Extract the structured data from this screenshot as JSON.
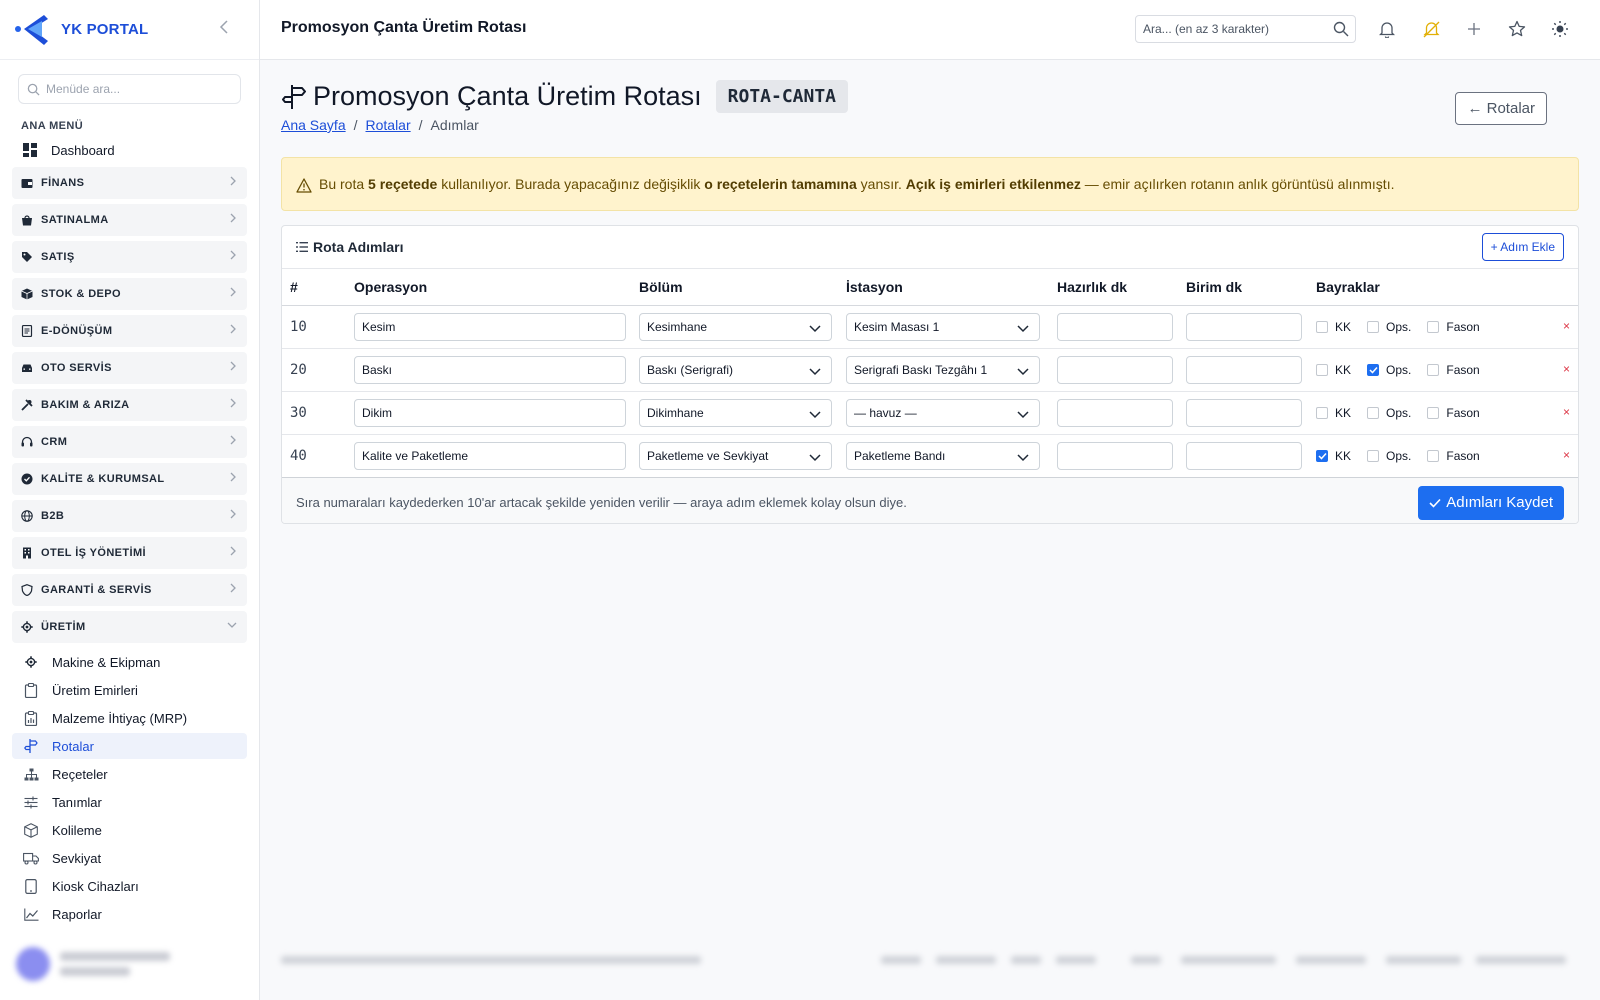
{
  "brand": {
    "name": "YK PORTAL"
  },
  "sidebar": {
    "search_placeholder": "Menüde ara...",
    "heading": "ANA MENÜ",
    "dashboard_label": "Dashboard",
    "groups": [
      {
        "label": "FİNANS",
        "icon": "wallet-icon"
      },
      {
        "label": "SATINALMA",
        "icon": "bag-icon"
      },
      {
        "label": "SATIŞ",
        "icon": "tag-icon"
      },
      {
        "label": "STOK & DEPO",
        "icon": "box-icon"
      },
      {
        "label": "E-DÖNÜŞÜM",
        "icon": "document-icon"
      },
      {
        "label": "OTO SERVİS",
        "icon": "car-icon"
      },
      {
        "label": "BAKIM & ARIZA",
        "icon": "tools-icon"
      },
      {
        "label": "CRM",
        "icon": "headset-icon"
      },
      {
        "label": "KALİTE & KURUMSAL",
        "icon": "check-badge-icon"
      },
      {
        "label": "B2B",
        "icon": "globe-icon"
      },
      {
        "label": "OTEL İŞ YÖNETİMİ",
        "icon": "building-icon"
      },
      {
        "label": "GARANTİ & SERVİS",
        "icon": "shield-icon"
      },
      {
        "label": "ÜRETİM",
        "icon": "gear-icon"
      }
    ],
    "sub_items": [
      {
        "label": "Makine & Ekipman",
        "icon": "gear-icon"
      },
      {
        "label": "Üretim Emirleri",
        "icon": "clipboard-icon"
      },
      {
        "label": "Malzeme İhtiyaç (MRP)",
        "icon": "clipboard-chart-icon"
      },
      {
        "label": "Rotalar",
        "icon": "signpost-icon"
      },
      {
        "label": "Reçeteler",
        "icon": "hierarchy-icon"
      },
      {
        "label": "Tanımlar",
        "icon": "sliders-icon"
      },
      {
        "label": "Kolileme",
        "icon": "package-icon"
      },
      {
        "label": "Sevkiyat",
        "icon": "truck-icon"
      },
      {
        "label": "Kiosk Cihazları",
        "icon": "tablet-icon"
      },
      {
        "label": "Raporlar",
        "icon": "graph-icon"
      }
    ]
  },
  "topbar": {
    "title": "Promosyon Çanta Üretim Rotası",
    "search_placeholder": "Ara... (en az 3 karakter)"
  },
  "page": {
    "title": "Promosyon Çanta Üretim Rotası",
    "code": "ROTA-CANTA",
    "back_label": "← Rotalar",
    "breadcrumb": {
      "home": "Ana Sayfa",
      "routes": "Rotalar",
      "current": "Adımlar",
      "separator": "/"
    }
  },
  "alert": {
    "t1": "Bu rota ",
    "b1": "5 reçetede",
    "t2": " kullanılıyor. Burada yapacağınız değişiklik ",
    "b2": "o reçetelerin tamamına",
    "t3": " yansır. ",
    "b3": "Açık iş emirleri etkilenmez",
    "t4": " — emir açılırken rotanın anlık görüntüsü alınmıştı."
  },
  "steps_card": {
    "title": "Rota Adımları",
    "add_label": "+ Adım Ekle",
    "columns": [
      "#",
      "Operasyon",
      "Bölüm",
      "İstasyon",
      "Hazırlık dk",
      "Birim dk",
      "Bayraklar"
    ],
    "flag_labels": {
      "kk": "KK",
      "ops": "Ops.",
      "fason": "Fason"
    },
    "delete_symbol": "×",
    "rows": [
      {
        "seq": "10",
        "operation": "Kesim",
        "department": "Kesimhane",
        "station": "Kesim Masası 1",
        "setup": "",
        "unit": "",
        "kk": false,
        "ops": false,
        "fason": false
      },
      {
        "seq": "20",
        "operation": "Baskı",
        "department": "Baskı (Serigrafi)",
        "station": "Serigrafi Baskı Tezgâhı 1",
        "setup": "",
        "unit": "",
        "kk": false,
        "ops": true,
        "fason": false
      },
      {
        "seq": "30",
        "operation": "Dikim",
        "department": "Dikimhane",
        "station": "— havuz —",
        "setup": "",
        "unit": "",
        "kk": false,
        "ops": false,
        "fason": false
      },
      {
        "seq": "40",
        "operation": "Kalite ve Paketleme",
        "department": "Paketleme ve Sevkiyat",
        "station": "Paketleme Bandı",
        "setup": "",
        "unit": "",
        "kk": true,
        "ops": false,
        "fason": false
      }
    ],
    "footer_note": "Sıra numaraları kaydederken 10'ar artacak şekilde yeniden verilir — araya adım eklemek kolay olsun diye.",
    "save_label": "Adımları Kaydet"
  },
  "colors": {
    "primary": "#1d6ef0",
    "link": "#1d4ed8",
    "alert_bg": "#fff3cd",
    "danger": "#dc3545"
  }
}
